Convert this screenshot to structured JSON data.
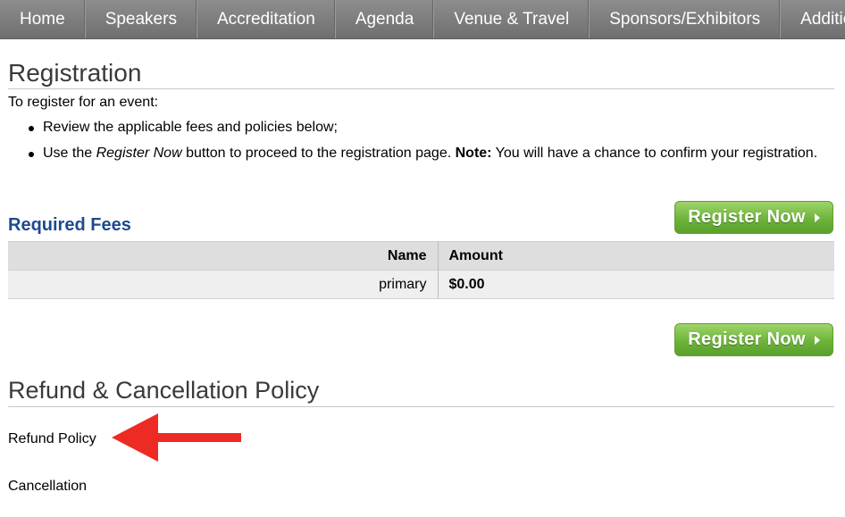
{
  "nav": {
    "items": [
      "Home",
      "Speakers",
      "Accreditation",
      "Agenda",
      "Venue & Travel",
      "Sponsors/Exhibitors",
      "Additio"
    ]
  },
  "registration": {
    "title": "Registration",
    "intro": "To register for an event:",
    "bullet1": "Review the applicable fees and policies below;",
    "bullet2_pre": "Use the ",
    "bullet2_em": "Register Now",
    "bullet2_mid": " button to proceed to the registration page.  ",
    "bullet2_note": "Note:",
    "bullet2_post": " You will have a chance to confirm your registration."
  },
  "fees": {
    "title": "Required Fees",
    "register_label": "Register Now",
    "columns": {
      "name": "Name",
      "amount": "Amount"
    },
    "rows": [
      {
        "name": "primary",
        "amount": "$0.00"
      }
    ]
  },
  "policy": {
    "title": "Refund & Cancellation Policy",
    "refund": "Refund Policy",
    "cancellation": "Cancellation"
  },
  "colors": {
    "nav_bg": "#7d7d7d",
    "heading_blue": "#1d4a8f",
    "button_green": "#6db43a",
    "arrow_red": "#ee2a24"
  }
}
